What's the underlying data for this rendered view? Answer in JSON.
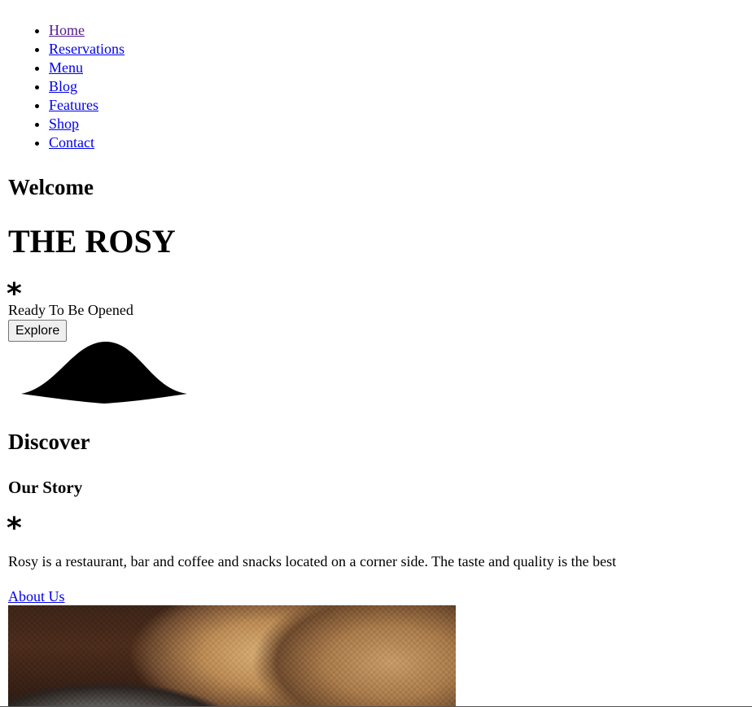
{
  "nav": {
    "items": [
      {
        "label": "Home",
        "visited": true
      },
      {
        "label": "Reservations",
        "visited": false
      },
      {
        "label": "Menu",
        "visited": false
      },
      {
        "label": "Blog",
        "visited": false
      },
      {
        "label": "Features",
        "visited": false
      },
      {
        "label": "Shop",
        "visited": false
      },
      {
        "label": "Contact",
        "visited": false
      }
    ]
  },
  "hero": {
    "welcome": "Welcome",
    "title": "THE ROSY",
    "asterisk": "*",
    "tagline": "Ready To Be Opened",
    "explore_label": "Explore",
    "wave_icon": "wave-divider-icon"
  },
  "story": {
    "discover": "Discover",
    "heading": "Our Story",
    "asterisk": "*",
    "text": "Rosy is a restaurant, bar and coffee and snacks located on a corner side. The taste and quality is the best",
    "about_label": "About Us",
    "photo": "coffee-sack-photo"
  },
  "colors": {
    "link": "#0000ee",
    "link_visited": "#551a8b",
    "button_bg": "#efefef",
    "button_border": "#767676"
  }
}
